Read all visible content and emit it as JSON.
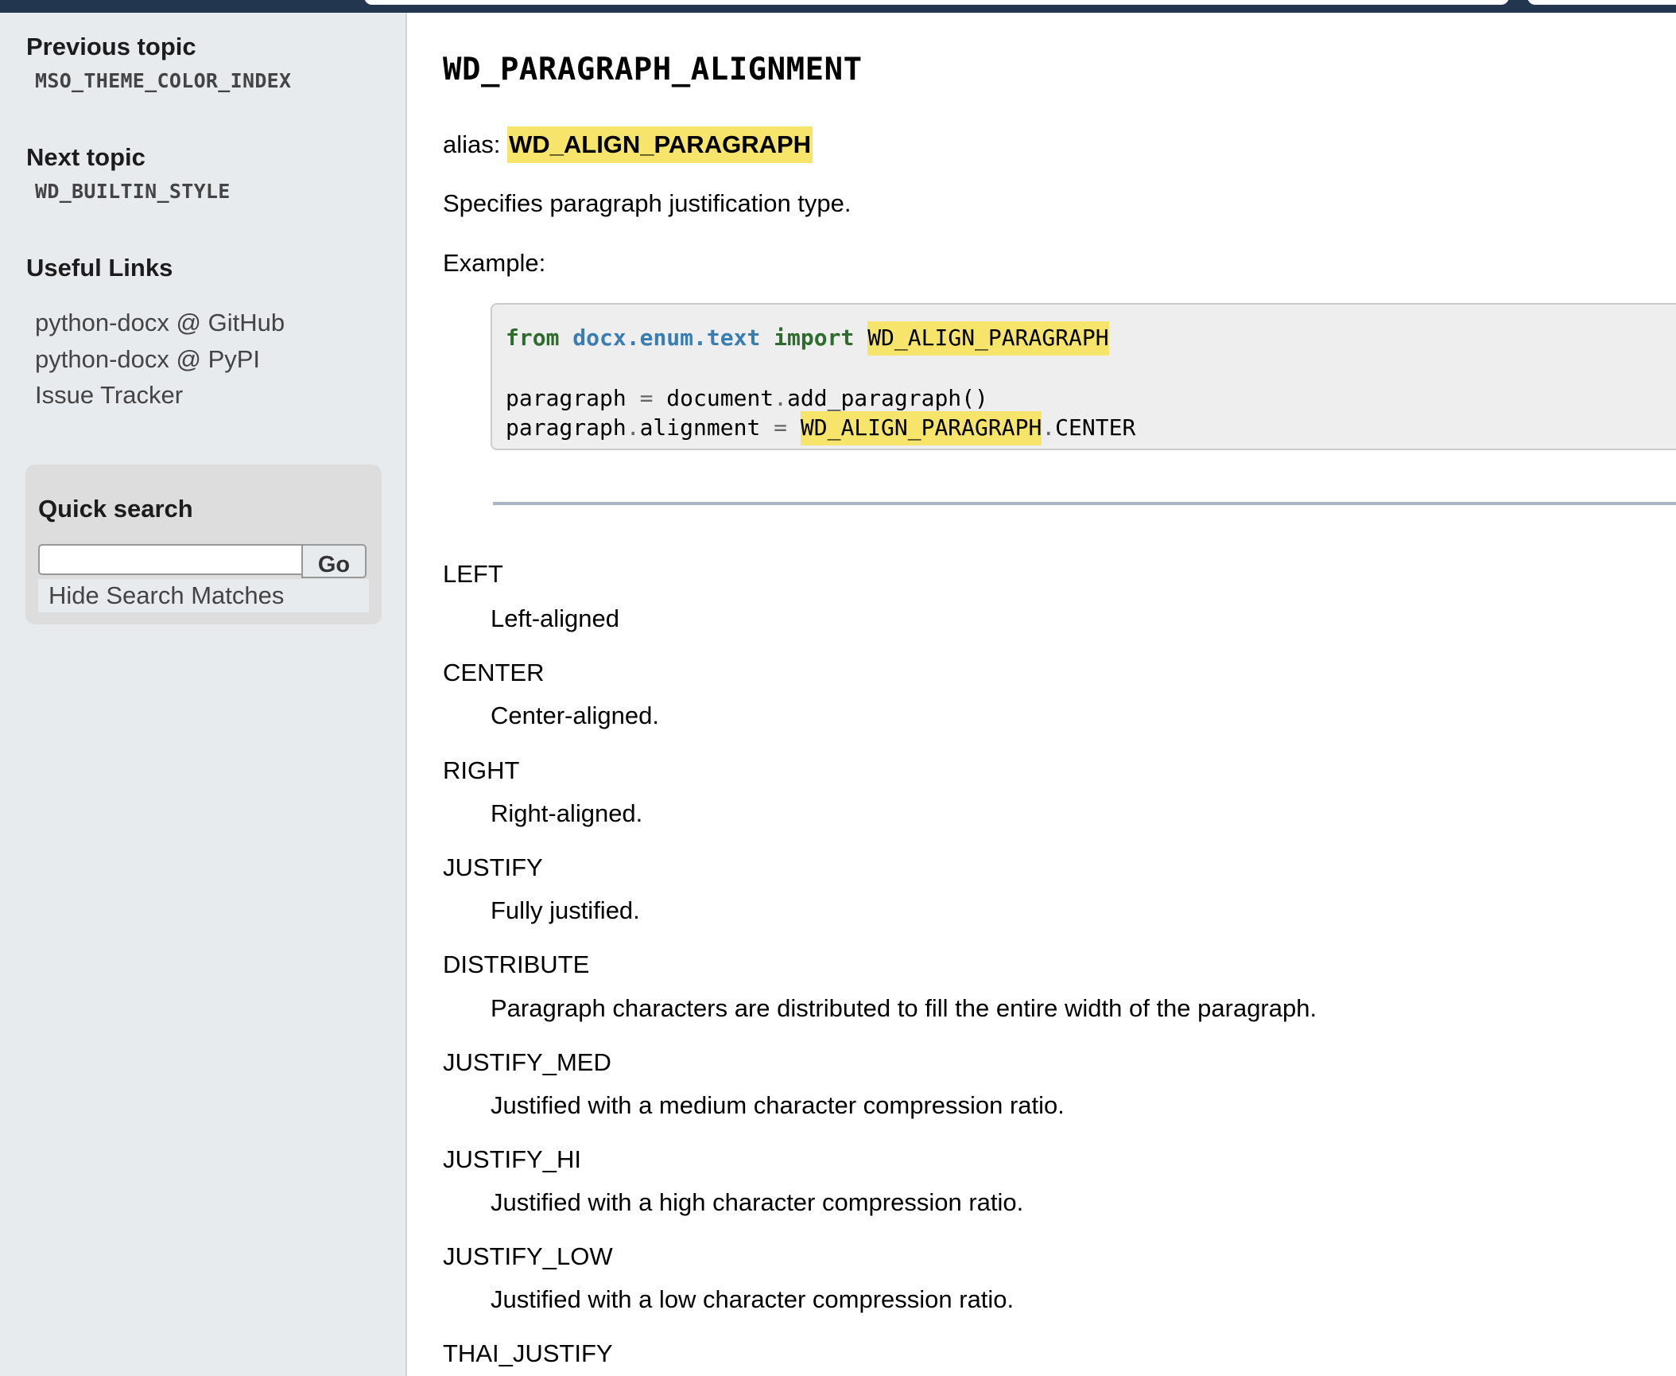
{
  "topbar": {
    "search_placeholder": ""
  },
  "sidebar": {
    "previous_topic": {
      "heading": "Previous topic",
      "link": "MSO_THEME_COLOR_INDEX"
    },
    "next_topic": {
      "heading": "Next topic",
      "link": "WD_BUILTIN_STYLE"
    },
    "useful_links": {
      "heading": "Useful Links",
      "items": [
        {
          "label": "python-docx @ GitHub"
        },
        {
          "label": "python-docx @ PyPI"
        },
        {
          "label": "Issue Tracker"
        }
      ]
    },
    "quick_search": {
      "heading": "Quick search",
      "input_value": "",
      "go_label": "Go",
      "hide_matches_label": "Hide Search Matches"
    }
  },
  "main": {
    "title": "WD_PARAGRAPH_ALIGNMENT",
    "alias_label": "alias: ",
    "alias_value": "WD_ALIGN_PARAGRAPH",
    "description": "Specifies paragraph justification type.",
    "example_label": "Example:",
    "code": {
      "line1": {
        "kw_from": "from",
        "module": "docx.enum.text",
        "kw_import": "import",
        "name": "WD_ALIGN_PARAGRAPH"
      },
      "line3": {
        "lhs": "paragraph",
        "op": "=",
        "obj": "document",
        "dot": ".",
        "call": "add_paragraph()"
      },
      "line4": {
        "obj": "paragraph",
        "dot": ".",
        "attr": "alignment",
        "op": "=",
        "name": "WD_ALIGN_PARAGRAPH",
        "dot2": ".",
        "member": "CENTER"
      }
    },
    "members": [
      {
        "name": "LEFT",
        "description": "Left-aligned"
      },
      {
        "name": "CENTER",
        "description": "Center-aligned."
      },
      {
        "name": "RIGHT",
        "description": "Right-aligned."
      },
      {
        "name": "JUSTIFY",
        "description": "Fully justified."
      },
      {
        "name": "DISTRIBUTE",
        "description": "Paragraph characters are distributed to fill the entire width of the paragraph."
      },
      {
        "name": "JUSTIFY_MED",
        "description": "Justified with a medium character compression ratio."
      },
      {
        "name": "JUSTIFY_HI",
        "description": "Justified with a high character compression ratio."
      },
      {
        "name": "JUSTIFY_LOW",
        "description": "Justified with a low character compression ratio."
      },
      {
        "name": "THAI_JUSTIFY",
        "description": ""
      }
    ]
  },
  "colors": {
    "navbar": "#233650",
    "sidebar_bg": "#e8ebee",
    "highlight": "#f6e56a",
    "keyword": "#2e6b2e",
    "module": "#3a7db0"
  }
}
